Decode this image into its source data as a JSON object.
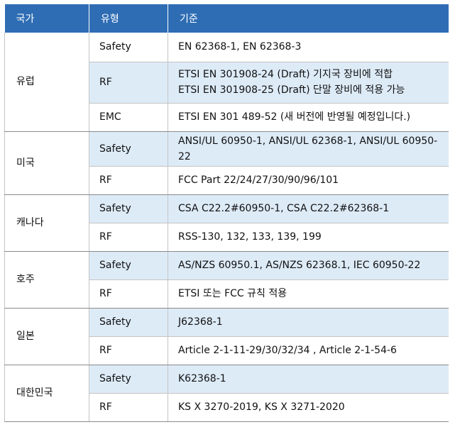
{
  "header": {
    "country": "국가",
    "type": "유형",
    "standard": "기준"
  },
  "rows": [
    {
      "country": "유럽",
      "type": "Safety",
      "standard": "EN 62368-1, EN 62368-3"
    },
    {
      "type": "RF",
      "standard": "ETSI EN 301908-24 (Draft) 기지국 장비에 적합",
      "standard_line2": "ETSI EN 301908-25 (Draft) 단말 장비에 적용 가능"
    },
    {
      "type": "EMC",
      "standard": "ETSI EN 301 489-52 (새 버전에 반영될 예정입니다.)"
    },
    {
      "country": "미국",
      "type": "Safety",
      "standard": "ANSI/UL 60950-1, ANSI/UL 62368-1, ANSI/UL 60950-22"
    },
    {
      "type": "RF",
      "standard": "FCC Part 22/24/27/30/90/96/101"
    },
    {
      "country": "캐나다",
      "type": "Safety",
      "standard": "CSA C22.2#60950-1, CSA C22.2#62368-1"
    },
    {
      "type": "RF",
      "standard": "RSS-130, 132, 133, 139, 199"
    },
    {
      "country": "호주",
      "type": "Safety",
      "standard": "AS/NZS 60950.1, AS/NZS 62368.1, IEC 60950-22"
    },
    {
      "type": "RF",
      "standard": "ETSI 또는 FCC 규칙 적용"
    },
    {
      "country": "일본",
      "type": "Safety",
      "standard": "J62368-1"
    },
    {
      "type": "RF",
      "standard": "Article 2-1-11-29/30/32/34 , Article 2-1-54-6"
    },
    {
      "country": "대한민국",
      "type": "Safety",
      "standard": "K62368-1"
    },
    {
      "type": "RF",
      "standard": "KS X 3270-2019, KS X 3271-2020"
    }
  ],
  "colors": {
    "header_bg": "#2e6db4",
    "shade_bg": "#ddebf7"
  }
}
